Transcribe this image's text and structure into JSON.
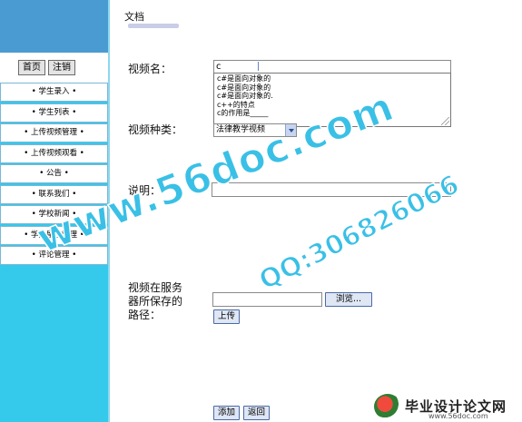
{
  "sidebar": {
    "home_label": "首页",
    "logout_label": "注销",
    "items": [
      {
        "label": "• 学生录入 •"
      },
      {
        "label": "• 学生列表 •"
      },
      {
        "label": "• 上传视频管理 •"
      },
      {
        "label": "• 上传视频观看 •"
      },
      {
        "label": "• 公告 •"
      },
      {
        "label": "• 联系我们 •"
      },
      {
        "label": "• 学校新闻 •"
      },
      {
        "label": "• 学生留言管理 •"
      },
      {
        "label": "• 评论管理 •"
      }
    ]
  },
  "main": {
    "title": "文档",
    "video_name": {
      "label": "视频名：",
      "value": "c",
      "suggestions": [
        {
          "text": "c#是面向对象的"
        },
        {
          "text": "c#是面向对象的"
        },
        {
          "text": "c#是面向对象的."
        },
        {
          "text": "c++的特点"
        },
        {
          "text": "c的作用是_____"
        }
      ]
    },
    "video_type": {
      "label": "视频种类：",
      "selected": "法律教学视频"
    },
    "description": {
      "label": "说明：",
      "value": ""
    },
    "server_path": {
      "label": "视频在服务器所保存的路径：",
      "value": "",
      "browse_label": "浏览...",
      "upload_label": "上传"
    },
    "add_label": "添加",
    "back_label": "返回"
  },
  "watermark": {
    "site": "www.56doc.com",
    "qq": "QQ:306826066",
    "brand_cn": "毕业设计论文网",
    "brand_url": "www.56doc.com"
  },
  "colors": {
    "sidebar_bg": "#35c9ec",
    "sidebar_top": "#4a9bd1",
    "watermark": "#3ac0e6"
  }
}
